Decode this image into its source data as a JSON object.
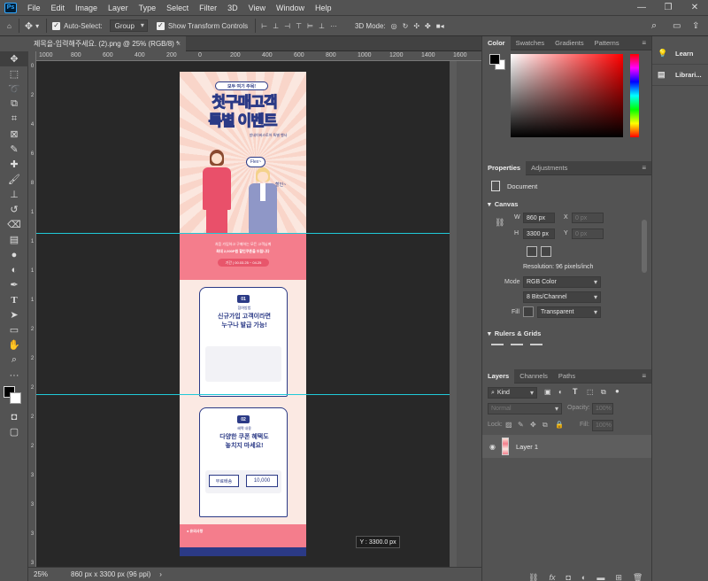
{
  "menu": [
    "File",
    "Edit",
    "Image",
    "Layer",
    "Type",
    "Select",
    "Filter",
    "3D",
    "View",
    "Window",
    "Help"
  ],
  "app_logo": "Ps",
  "window_controls": [
    "minimize-icon",
    "maximize-icon",
    "close-icon"
  ],
  "options": {
    "auto_select_label": "Auto-Select:",
    "auto_select_value": "Group",
    "transform_label": "Show Transform Controls",
    "mode_3d_label": "3D Mode:"
  },
  "doc_tab": {
    "title": "제목을-입력해주세요. (2).png @ 25% (RGB/8) *",
    "close": "×"
  },
  "ruler_h": [
    "1000",
    "800",
    "600",
    "400",
    "200",
    "0",
    "200",
    "400",
    "600",
    "800",
    "1000",
    "1200",
    "1400",
    "1600",
    "1800"
  ],
  "ruler_v": [
    "0",
    "2",
    "4",
    "6",
    "8",
    "1",
    "1",
    "1",
    "1",
    "2",
    "2",
    "2",
    "2",
    "2",
    "3",
    "3",
    "3",
    "3"
  ],
  "status": {
    "zoom": "25%",
    "info": "860 px x 3300 px (96 ppi)"
  },
  "readout": "Y :  3300.0 px",
  "color_panel": {
    "tabs": [
      "Color",
      "Swatches",
      "Gradients",
      "Patterns"
    ],
    "accent": "#ff0000"
  },
  "properties": {
    "tabs": [
      "Properties",
      "Adjustments"
    ],
    "document_label": "Document",
    "canvas_label": "Canvas",
    "w_label": "W",
    "w_value": "860 px",
    "h_label": "H",
    "h_value": "3300 px",
    "x_label": "X",
    "x_value": "0 px",
    "y_label": "Y",
    "y_value": "0 px",
    "resolution": "Resolution: 96 pixels/inch",
    "mode_label": "Mode",
    "mode_value": "RGB Color",
    "depth_value": "8 Bits/Channel",
    "fill_label": "Fill",
    "fill_value": "Transparent",
    "rulers_label": "Rulers & Grids"
  },
  "layers": {
    "tabs": [
      "Layers",
      "Channels",
      "Paths"
    ],
    "kind_value": "Kind",
    "blend_value": "Normal",
    "opacity_label": "Opacity:",
    "opacity_value": "100%",
    "lock_label": "Lock:",
    "fill_label": "Fill:",
    "fill_value": "100%",
    "layer_name": "Layer 1"
  },
  "right_col": {
    "learn": "Learn",
    "libraries": "Librari..."
  },
  "artwork": {
    "badge": "모두 여기 주목!",
    "headline1": "첫구매",
    "headline1b": "고객",
    "headline2": "특별 이벤트",
    "subtitle": "방네이버스토어 특별 행사",
    "speech1": "Flex~",
    "speech2": "할인~",
    "band_line1": "처음 가입하고 구매하는 모든 고객님께",
    "band_line2": "최대 2,000P원 할인쿠폰을 드립니다",
    "band_pill": "기간 | 00.03.25 ~ 04.25",
    "card1_num": "01",
    "card1_tag": "참여방법",
    "card1_line1": "신규가입 고객이라면",
    "card1_line2": "누구나 발급 가능!",
    "card2_num": "02",
    "card2_tag": "혜택 내용",
    "card2_line1": "다양한 쿠폰 혜택도",
    "card2_line2": "놓치지 마세요!",
    "coupon1": "무료배송",
    "coupon2": "10,000",
    "notice": "● 유의사항",
    "colors": {
      "pink": "#f47d8c",
      "navy": "#2b3a86",
      "orange": "#f5a623",
      "peach": "#f8e4dc"
    }
  }
}
